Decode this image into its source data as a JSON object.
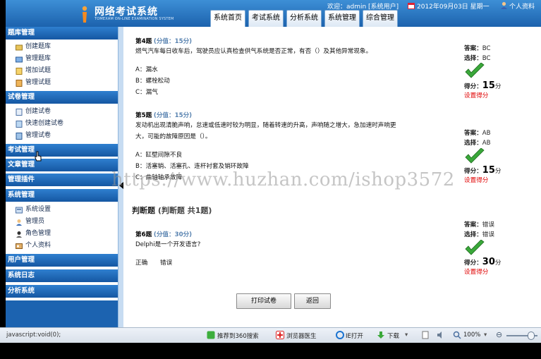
{
  "app": {
    "title": "网络考试系统",
    "subtitle": "TOMEXAM ON-LINE EXAMINATION SYSTEM"
  },
  "topbar": {
    "welcome": "欢迎：admin [系统用户]",
    "date": "2012年09月03日 星期一",
    "profile": "个人资料"
  },
  "nav": {
    "tabs": [
      "系统首页",
      "考试系统",
      "分析系统",
      "系统管理",
      "综合管理"
    ]
  },
  "sidebar": {
    "sections": [
      {
        "title": "题库管理",
        "items": [
          "创建题库",
          "管理题库",
          "增加试题",
          "管理试题"
        ]
      },
      {
        "title": "试卷管理",
        "items": [
          "创建试卷",
          "快速创建试卷",
          "管理试卷"
        ]
      },
      {
        "title": "考试管理",
        "items": []
      },
      {
        "title": "文章管理",
        "items": []
      },
      {
        "title": "管理插件",
        "items": []
      },
      {
        "title": "系统管理",
        "items": [
          "系统设置",
          "管理员",
          "角色管理",
          "个人资料"
        ]
      },
      {
        "title": "用户管理",
        "items": []
      },
      {
        "title": "系统日志",
        "items": []
      },
      {
        "title": "分析系统",
        "items": []
      }
    ]
  },
  "questions": [
    {
      "num": "第4题",
      "meta": "(分值：15分)",
      "text": "燃气汽车每日收车后，驾驶员应认真检查供气系统是否正常，有否（）及其他异常现象。",
      "options": [
        "A：漏水",
        "B：螺栓松动",
        "C：漏气"
      ],
      "answer_label": "答案：",
      "answer": "BC",
      "choice_label": "选择：",
      "choice": "BC",
      "score_label": "得分：",
      "score": "15",
      "score_unit": "分",
      "set_score": "设置得分"
    },
    {
      "num": "第5题",
      "meta": "(分值：15分)",
      "text_line1": "发动机出现清脆声响，怠速或低速时较为明显，随着转速的升高，声响随之增大，急加速时声响更",
      "text_line2": "大，可能的故障原因是（）。",
      "options": [
        "A：缸壁间隙不良",
        "B：活塞销、活塞孔、连杆衬套及销环故障",
        "C：曲轴轴承故障"
      ],
      "answer_label": "答案：",
      "answer": "AB",
      "choice_label": "选择：",
      "choice": "AB",
      "score_label": "得分：",
      "score": "15",
      "score_unit": "分",
      "set_score": "设置得分"
    },
    {
      "num": "第6题",
      "meta": "(分值：30分)",
      "text": "Delphi是一个开发语言?",
      "options": [
        "正确",
        "错误"
      ],
      "answer_label": "答案：",
      "answer": "错误",
      "choice_label": "选择：",
      "choice": "错误",
      "score_label": "得分：",
      "score": "30",
      "score_unit": "分",
      "set_score": "设置得分"
    }
  ],
  "judge_section": {
    "title": "判断题",
    "sub": "(判断题  共1题)"
  },
  "buttons": {
    "print": "打印试卷",
    "back": "返回"
  },
  "watermark": "https://www.huzhan.com/ishop3572",
  "statusbar": {
    "url": "javascript:void(0);",
    "recommend": "推荐到360搜索",
    "doctor": "浏览器医生",
    "ie_open": "IE打开",
    "download": "下载",
    "zoom": "100%"
  },
  "colors": {
    "header_blue": "#1c62ad",
    "section_blue": "#1557a2",
    "score_red": "#e00000",
    "check_green": "#3aa83a"
  }
}
